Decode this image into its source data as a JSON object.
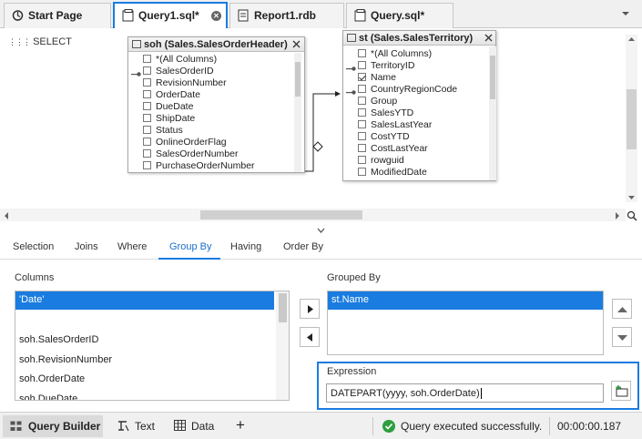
{
  "tabs": [
    {
      "label": "Start Page",
      "icon": "start-page-icon"
    },
    {
      "label": "Query1.sql*",
      "icon": "sql-file-icon",
      "active": true
    },
    {
      "label": "Report1.rdb",
      "icon": "report-icon"
    },
    {
      "label": "Query.sql*",
      "icon": "sql-file-icon"
    }
  ],
  "designer": {
    "select_label": "SELECT",
    "table1": {
      "title": "soh (Sales.SalesOrderHeader)",
      "columns": [
        "*(All Columns)",
        "SalesOrderID",
        "RevisionNumber",
        "OrderDate",
        "DueDate",
        "ShipDate",
        "Status",
        "OnlineOrderFlag",
        "SalesOrderNumber",
        "PurchaseOrderNumber"
      ]
    },
    "table2": {
      "title": "st (Sales.SalesTerritory)",
      "columns": [
        "*(All Columns)",
        "TerritoryID",
        "Name",
        "CountryRegionCode",
        "Group",
        "SalesYTD",
        "SalesLastYear",
        "CostYTD",
        "CostLastYear",
        "rowguid",
        "ModifiedDate"
      ],
      "checked": [
        "Name"
      ]
    }
  },
  "subtabs": [
    "Selection",
    "Joins",
    "Where",
    "Group By",
    "Having",
    "Order By"
  ],
  "active_subtab": "Group By",
  "groupby": {
    "columns_label": "Columns",
    "columns": [
      "'Date'",
      "",
      "soh.SalesOrderID",
      "soh.RevisionNumber",
      "soh.OrderDate",
      "soh.DueDate"
    ],
    "grouped_by_label": "Grouped By",
    "grouped_by": [
      "st.Name"
    ],
    "expression_label": "Expression",
    "expression_value": "DATEPART(yyyy, soh.OrderDate)"
  },
  "status": {
    "query_builder": "Query Builder",
    "text": "Text",
    "data": "Data",
    "add": "+",
    "message": "Query executed successfully.",
    "time": "00:00:00.187"
  },
  "colors": {
    "accent": "#1a7ce0",
    "success": "#2e9e3e"
  }
}
